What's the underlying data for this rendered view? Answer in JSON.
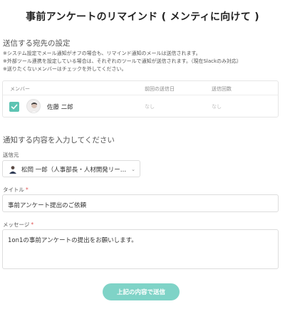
{
  "page": {
    "title": "事前アンケートのリマインド ( メンティに向けて )"
  },
  "destination": {
    "heading": "送信する宛先の設定",
    "notes": [
      "※システム設定でメール通知がオフの場合も、リマインド通知のメールは送信されます。",
      "※外部ツール連携を設定している場合は、それぞれのツールで通知が送信されます。（現在Slackのみ対応）",
      "※送りたくないメンバーはチェックを外してください。"
    ],
    "table": {
      "headers": {
        "member": "メンバー",
        "last_sent": "前回の送信日",
        "count": "送信回数"
      },
      "rows": [
        {
          "name": "佐藤 二郎",
          "last_sent": "なし",
          "count": "なし",
          "checked": true
        }
      ]
    }
  },
  "content": {
    "heading": "通知する内容を入力してください",
    "sender_label": "送信元",
    "sender_value": "松岡 一郎（人事部長・人材開発リーダ…",
    "title_label": "タイトル",
    "title_value": "事前アンケート提出のご依頼",
    "message_label": "メッセージ",
    "message_value": "1on1の事前アンケートの提出をお願いします。",
    "required_mark": "*",
    "submit_label": "上記の内容で送信"
  },
  "colors": {
    "accent": "#5ec4b3",
    "button": "#7fd3c7",
    "required": "#e05555"
  },
  "icons": {
    "check": "check-icon",
    "avatar": "user-avatar",
    "sender": "person-icon",
    "dropdown": "chevron-down-icon"
  }
}
